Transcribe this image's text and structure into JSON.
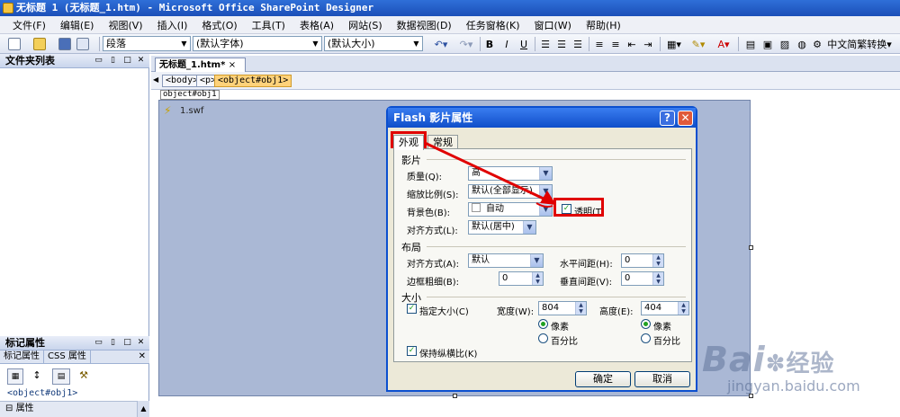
{
  "window": {
    "title": "无标题 1 (无标题_1.htm) - Microsoft Office SharePoint Designer"
  },
  "menu": [
    "文件(F)",
    "编辑(E)",
    "视图(V)",
    "插入(I)",
    "格式(O)",
    "工具(T)",
    "表格(A)",
    "网站(S)",
    "数据视图(D)",
    "任务窗格(K)",
    "窗口(W)",
    "帮助(H)"
  ],
  "toolbar": {
    "style_value": "段落",
    "font_value": "(默认字体)",
    "size_value": "(默认大小)",
    "bold": "B",
    "italic": "I",
    "underline": "U",
    "convert_label": "中文简繁转换"
  },
  "left_top": {
    "title": "文件夹列表"
  },
  "left_bottom": {
    "title": "标记属性",
    "tab1": "标记属性",
    "tab2": "CSS 属性",
    "tag_value": "<object#obj1>",
    "section": "属性"
  },
  "doc": {
    "tab_label": "无标题_1.htm*",
    "crumbs": [
      "<body>",
      "<p>",
      "<object#obj1>"
    ],
    "object_label": "object#obj1",
    "swf_name": "1.swf"
  },
  "dialog": {
    "title": "Flash 影片属性",
    "tab_appearance": "外观",
    "tab_general": "常规",
    "movie_group": "影片",
    "quality_label": "质量(Q):",
    "quality_value": "高",
    "scale_label": "缩放比例(S):",
    "scale_value": "默认(全部显示)",
    "bgcolor_label": "背景色(B):",
    "bgcolor_value": "自动",
    "transparent_label": "透明(T)",
    "align_label": "对齐方式(L):",
    "align_value": "默认(居中)",
    "layout_group": "布局",
    "layout_align_label": "对齐方式(A):",
    "layout_align_value": "默认",
    "hspace_label": "水平间距(H):",
    "hspace_value": "0",
    "border_label": "边框粗细(B):",
    "border_value": "0",
    "vspace_label": "垂直间距(V):",
    "vspace_value": "0",
    "size_group": "大小",
    "specify_size_label": "指定大小(C)",
    "width_label": "宽度(W):",
    "width_value": "804",
    "height_label": "高度(E):",
    "height_value": "404",
    "unit_pixels": "像素",
    "unit_percent": "百分比",
    "keep_ratio_label": "保持纵横比(K)",
    "ok_label": "确定",
    "cancel_label": "取消"
  },
  "watermark": {
    "brand": "Bai",
    "sub": "jingyan.baidu.com",
    "cn": "经验"
  }
}
